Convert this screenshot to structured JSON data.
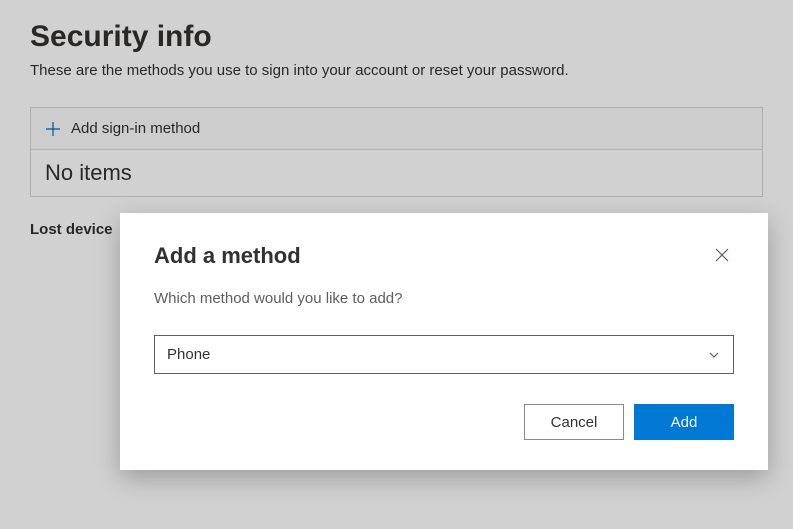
{
  "page": {
    "title": "Security info",
    "subtitle": "These are the methods you use to sign into your account or reset your password.",
    "add_method_label": "Add sign-in method",
    "no_items_text": "No items",
    "lost_device_text": "Lost device"
  },
  "modal": {
    "title": "Add a method",
    "prompt": "Which method would you like to add?",
    "selected_option": "Phone",
    "cancel_label": "Cancel",
    "add_label": "Add"
  }
}
